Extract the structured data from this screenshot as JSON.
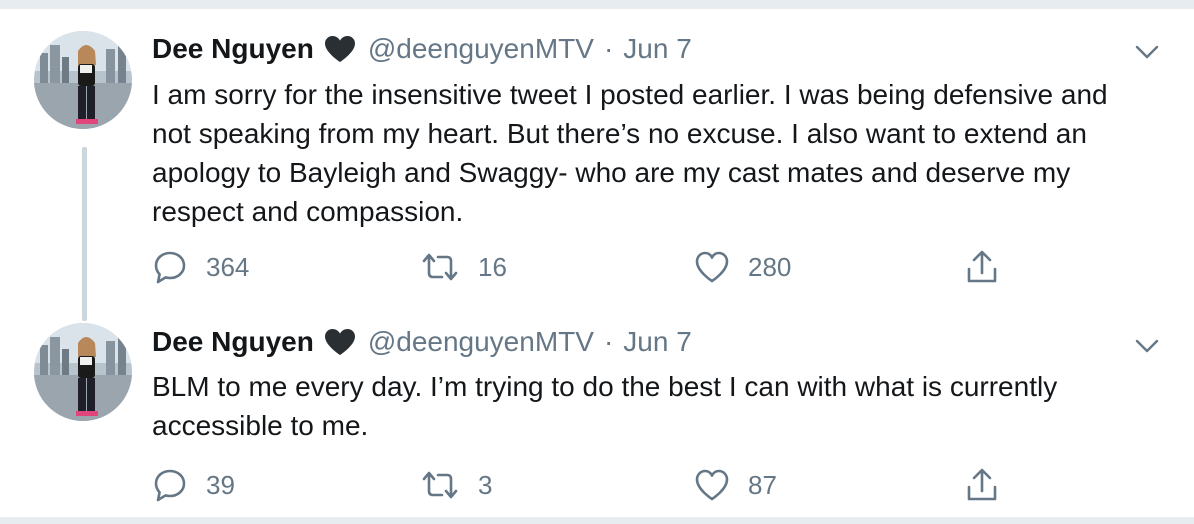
{
  "colors": {
    "text_primary": "#14171a",
    "text_secondary": "#657786",
    "divider": "#e6ecf0",
    "thread_line": "#ccd6dd"
  },
  "tweets": [
    {
      "name": "Dee Nguyen",
      "name_badge_icon": "black-heart-icon",
      "handle": "@deenguyenMTV",
      "separator": "·",
      "date": "Jun 7",
      "text": "I am sorry for the insensitive tweet I posted earlier. I was being defensive and not speaking from my heart. But there’s no excuse. I also want to extend an apology to Bayleigh and Swaggy- who are my cast mates and deserve my respect and compassion.",
      "replies": "364",
      "retweets": "16",
      "likes": "280"
    },
    {
      "name": "Dee Nguyen",
      "name_badge_icon": "black-heart-icon",
      "handle": "@deenguyenMTV",
      "separator": "·",
      "date": "Jun 7",
      "text": "BLM to me every day. I’m trying to do the best I can with what is currently accessible to me.",
      "replies": "39",
      "retweets": "3",
      "likes": "87"
    }
  ],
  "icons": {
    "reply": "reply-icon",
    "retweet": "retweet-icon",
    "like": "like-heart-icon",
    "share": "share-icon",
    "menu": "chevron-down-icon"
  }
}
